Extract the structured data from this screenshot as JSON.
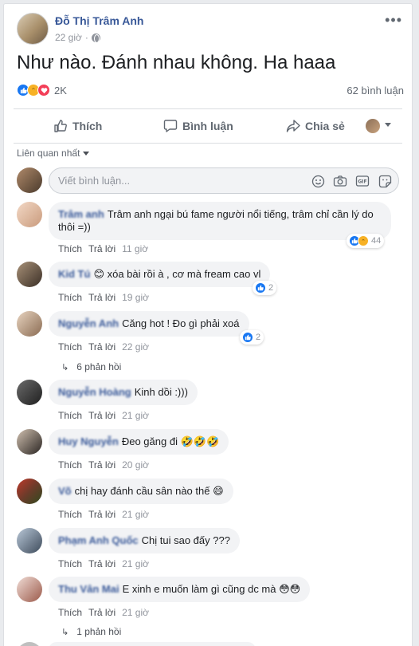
{
  "post": {
    "author": "Đỗ Thị Trâm Anh",
    "time": "22 giờ",
    "text": "Như nào. Đánh nhau không. Ha haaa",
    "reaction_count": "2K",
    "comment_count": "62 bình luận",
    "colors": {
      "link": "#385898",
      "like": "#1877f2",
      "haha": "#f7b125",
      "love": "#f33e58"
    }
  },
  "actions": {
    "like": "Thích",
    "comment": "Bình luận",
    "share": "Chia sẻ"
  },
  "sort_label": "Liên quan nhất",
  "comment_input": {
    "placeholder": "Viết bình luận..."
  },
  "comment_labels": {
    "like": "Thích",
    "reply": "Trả lời"
  },
  "comments": [
    {
      "name": "Trâm anh",
      "text": "Trâm anh ngại bú fame người nổi tiếng, trâm chỉ cần lý do thôi =))",
      "time": "11 giờ",
      "reactions": "44"
    },
    {
      "name": "Kid Tú",
      "text": "😊 xóa bài rồi à , cơ mà fream cao vl",
      "time": "19 giờ",
      "reactions": "2"
    },
    {
      "name": "Nguyễn Anh",
      "text": "Căng hot ! Đ‌o gì phải xoá",
      "time": "22 giờ",
      "reactions": "2",
      "replies": "6 phản hồi"
    },
    {
      "name": "Nguyễn Hoàng",
      "text": "Kinh dồi :)))",
      "time": "21 giờ"
    },
    {
      "name": "Huy Nguyễn",
      "text": "Đeo găng đi 🤣🤣🤣",
      "time": "20 giờ"
    },
    {
      "name": "Võ",
      "text": "chị hay đánh cầu sân nào thế 😄",
      "time": "21 giờ"
    },
    {
      "name": "Phạm Anh Quốc",
      "text": "Chị tui sao đấy ???",
      "time": "21 giờ"
    },
    {
      "name": "Thu Vân Mai",
      "text": "E xinh e muốn làm gì cũng dc mà 😳😳",
      "time": "21 giờ",
      "replies": "1 phản hồi"
    }
  ]
}
